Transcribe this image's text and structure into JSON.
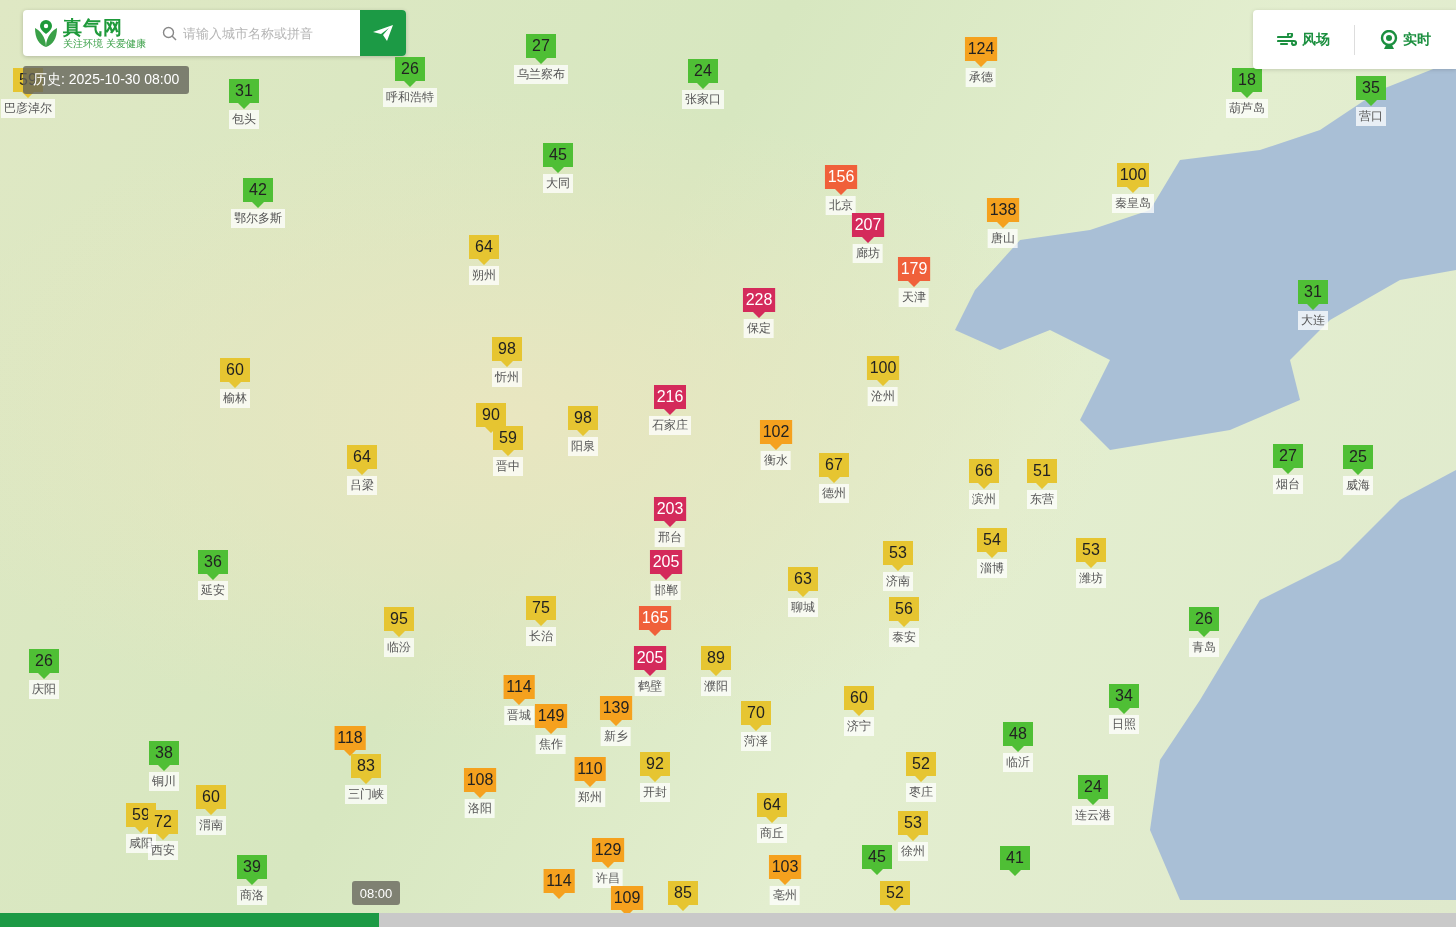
{
  "search": {
    "logo": "真气网",
    "tagline": "关注环境 关爱健康",
    "placeholder": "请输入城市名称或拼音"
  },
  "history_label": "历史: 2025-10-30 08:00",
  "toolbar": [
    {
      "label": "风场",
      "kind": "wind"
    },
    {
      "label": "实时",
      "kind": "live"
    }
  ],
  "markers": [
    {
      "value": "59",
      "name": "巴彦淖尔",
      "color": "#e6c531"
    },
    {
      "value": "31",
      "name": "包头",
      "color": "#4fbf35"
    },
    {
      "value": "26",
      "name": "呼和浩特",
      "color": "#4fbf35"
    },
    {
      "value": "27",
      "name": "乌兰察布",
      "color": "#4fbf35"
    },
    {
      "value": "24",
      "name": "张家口",
      "color": "#4fbf35"
    },
    {
      "value": "124",
      "name": "承德",
      "color": "#f5a11e"
    },
    {
      "value": "18",
      "name": "葫芦岛",
      "color": "#4fbf35"
    },
    {
      "value": "35",
      "name": "营口",
      "color": "#4fbf35"
    },
    {
      "value": "45",
      "name": "大同",
      "color": "#4fbf35"
    },
    {
      "value": "42",
      "name": "鄂尔多斯",
      "color": "#4fbf35"
    },
    {
      "value": "156",
      "name": "北京",
      "color": "#f0603a"
    },
    {
      "value": "207",
      "name": "廊坊",
      "color": "#d42a5b"
    },
    {
      "value": "100",
      "name": "秦皇岛",
      "color": "#e6c531"
    },
    {
      "value": "138",
      "name": "唐山",
      "color": "#f5a11e"
    },
    {
      "value": "64",
      "name": "朔州",
      "color": "#e6c531"
    },
    {
      "value": "179",
      "name": "天津",
      "color": "#f0603a"
    },
    {
      "value": "228",
      "name": "保定",
      "color": "#d42a5b"
    },
    {
      "value": "31",
      "name": "大连",
      "color": "#4fbf35"
    },
    {
      "value": "98",
      "name": "忻州",
      "color": "#e6c531"
    },
    {
      "value": "60",
      "name": "榆林",
      "color": "#e6c531"
    },
    {
      "value": "100",
      "name": "沧州",
      "color": "#e6c531"
    },
    {
      "value": "90",
      "color": "#e6c531"
    },
    {
      "value": "98",
      "name": "阳泉",
      "color": "#e6c531"
    },
    {
      "value": "216",
      "name": "石家庄",
      "color": "#d42a5b"
    },
    {
      "value": "59",
      "name": "晋中",
      "color": "#e6c531"
    },
    {
      "value": "102",
      "name": "衡水",
      "color": "#f5a11e"
    },
    {
      "value": "64",
      "name": "吕梁",
      "color": "#e6c531"
    },
    {
      "value": "67",
      "name": "德州",
      "color": "#e6c531"
    },
    {
      "value": "66",
      "name": "滨州",
      "color": "#e6c531"
    },
    {
      "value": "51",
      "name": "东营",
      "color": "#e6c531"
    },
    {
      "value": "27",
      "name": "烟台",
      "color": "#4fbf35"
    },
    {
      "value": "25",
      "name": "威海",
      "color": "#4fbf35"
    },
    {
      "value": "203",
      "name": "邢台",
      "color": "#d42a5b"
    },
    {
      "value": "36",
      "name": "延安",
      "color": "#4fbf35"
    },
    {
      "value": "205",
      "name": "邯郸",
      "color": "#d42a5b"
    },
    {
      "value": "63",
      "name": "聊城",
      "color": "#e6c531"
    },
    {
      "value": "53",
      "name": "济南",
      "color": "#e6c531"
    },
    {
      "value": "54",
      "name": "淄博",
      "color": "#e6c531"
    },
    {
      "value": "53",
      "name": "潍坊",
      "color": "#e6c531"
    },
    {
      "value": "95",
      "name": "临汾",
      "color": "#e6c531"
    },
    {
      "value": "75",
      "name": "长治",
      "color": "#e6c531"
    },
    {
      "value": "165",
      "color": "#f0603a"
    },
    {
      "value": "56",
      "name": "泰安",
      "color": "#e6c531"
    },
    {
      "value": "26",
      "name": "青岛",
      "color": "#4fbf35"
    },
    {
      "value": "26",
      "name": "庆阳",
      "color": "#4fbf35"
    },
    {
      "value": "205",
      "name": "鹤壁",
      "color": "#d42a5b"
    },
    {
      "value": "89",
      "name": "濮阳",
      "color": "#e6c531"
    },
    {
      "value": "114",
      "name": "晋城",
      "color": "#f5a11e"
    },
    {
      "value": "149",
      "name": "焦作",
      "color": "#f5a11e"
    },
    {
      "value": "139",
      "name": "新乡",
      "color": "#f5a11e"
    },
    {
      "value": "70",
      "name": "菏泽",
      "color": "#e6c531"
    },
    {
      "value": "60",
      "name": "济宁",
      "color": "#e6c531"
    },
    {
      "value": "34",
      "name": "日照",
      "color": "#4fbf35"
    },
    {
      "value": "38",
      "name": "铜川",
      "color": "#4fbf35"
    },
    {
      "value": "118",
      "color": "#f5a11e"
    },
    {
      "value": "83",
      "name": "三门峡",
      "color": "#e6c531"
    },
    {
      "value": "48",
      "name": "临沂",
      "color": "#4fbf35"
    },
    {
      "value": "110",
      "name": "郑州",
      "color": "#f5a11e"
    },
    {
      "value": "92",
      "name": "开封",
      "color": "#e6c531"
    },
    {
      "value": "52",
      "name": "枣庄",
      "color": "#e6c531"
    },
    {
      "value": "108",
      "name": "洛阳",
      "color": "#f5a11e"
    },
    {
      "value": "60",
      "name": "渭南",
      "color": "#e6c531"
    },
    {
      "value": "59",
      "name": "咸阳",
      "color": "#e6c531"
    },
    {
      "value": "72",
      "name": "西安",
      "color": "#e6c531"
    },
    {
      "value": "24",
      "name": "连云港",
      "color": "#4fbf35"
    },
    {
      "value": "64",
      "name": "商丘",
      "color": "#e6c531"
    },
    {
      "value": "53",
      "name": "徐州",
      "color": "#e6c531"
    },
    {
      "value": "39",
      "name": "商洛",
      "color": "#4fbf35"
    },
    {
      "value": "129",
      "name": "许昌",
      "color": "#f5a11e"
    },
    {
      "value": "103",
      "name": "亳州",
      "color": "#f5a11e"
    },
    {
      "value": "45",
      "color": "#4fbf35"
    },
    {
      "value": "41",
      "color": "#4fbf35"
    },
    {
      "value": "114",
      "color": "#f5a11e"
    },
    {
      "value": "109",
      "color": "#f5a11e"
    },
    {
      "value": "85",
      "color": "#e6c531"
    },
    {
      "value": "52",
      "color": "#e6c531"
    }
  ],
  "timeline": {
    "time": "08:00",
    "level": 0.26
  }
}
